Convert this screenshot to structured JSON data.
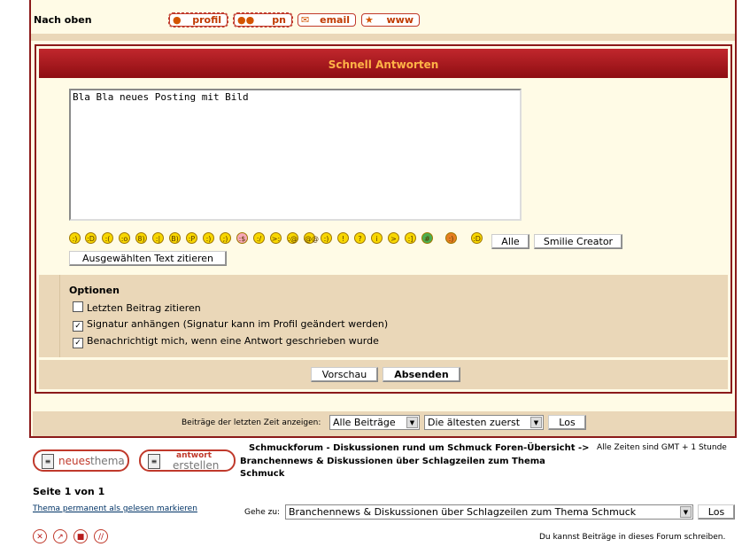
{
  "top": {
    "label": "Nach oben",
    "buttons": [
      {
        "name": "profil",
        "label": "profil",
        "icon": "user-icon"
      },
      {
        "name": "pn",
        "label": "pn",
        "icon": "users-icon"
      },
      {
        "name": "email",
        "label": "email",
        "icon": "envelope-icon"
      },
      {
        "name": "www",
        "label": "www",
        "icon": "globe-icon"
      }
    ]
  },
  "quick_reply": {
    "title": "Schnell Antworten",
    "message": "Bla Bla neues Posting mit Bild",
    "all_button": "Alle",
    "smilie_creator": "Smilie Creator",
    "quote_selected": "Ausgewählten Text zitieren",
    "options_title": "Optionen",
    "options": [
      {
        "label": "Letzten Beitrag zitieren",
        "checked": false
      },
      {
        "label": "Signatur anhängen (Signatur kann im Profil geändert werden)",
        "checked": true
      },
      {
        "label": "Benachrichtigt mich, wenn eine Antwort geschrieben wurde",
        "checked": true
      }
    ],
    "preview": "Vorschau",
    "submit": "Absenden"
  },
  "filter": {
    "label": "Beiträge der letzten Zeit anzeigen:",
    "period": "Alle Beiträge",
    "order": "Die ältesten zuerst",
    "go": "Los"
  },
  "bottom": {
    "new_topic": {
      "prefix": "neues",
      "suffix": "thema"
    },
    "reply": {
      "line1": "antwort",
      "line2": "erstellen"
    },
    "breadcrumb_line1": "Schmuckforum - Diskussionen rund um Schmuck Foren-Übersicht ->",
    "breadcrumb_line2": "Branchennews & Diskussionen über Schlagzeilen zum Thema",
    "breadcrumb_line3": "Schmuck",
    "timezone": "Alle Zeiten sind GMT + 1 Stunde",
    "page": "Seite 1 von 1",
    "mark_read": "Thema permanent als gelesen markieren",
    "jump_label": "Gehe zu:",
    "jump_value": "Branchennews & Diskussionen über Schlagzeilen zum Thema Schmuck",
    "jump_go": "Los",
    "can_post": "Du kannst Beiträge in dieses Forum schreiben."
  },
  "colors": {
    "accent": "#8b1a1a",
    "header_text": "#ffb347",
    "band": "#ead7b8",
    "panel": "#fffbe6"
  }
}
